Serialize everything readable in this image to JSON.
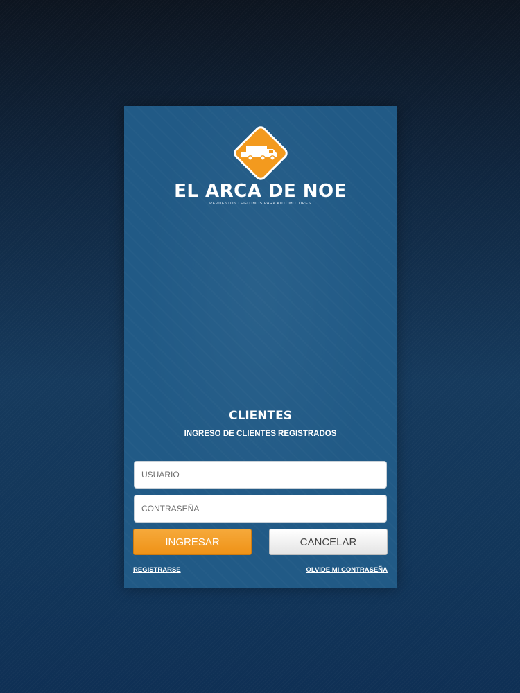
{
  "brand": {
    "name": "EL ARCA DE NOE",
    "tagline": "REPUESTOS LEGITIMOS PARA AUTOMOTORES",
    "accent_color": "#f39a1e",
    "logo_icon": "truck-icon"
  },
  "login": {
    "title": "CLIENTES",
    "subtitle": "INGRESO DE CLIENTES REGISTRADOS",
    "username_placeholder": "USUARIO",
    "password_placeholder": "CONTRASEÑA",
    "submit_label": "INGRESAR",
    "cancel_label": "CANCELAR",
    "register_link": "REGISTRARSE",
    "forgot_link": "OLVIDE MI CONTRASEÑA"
  }
}
